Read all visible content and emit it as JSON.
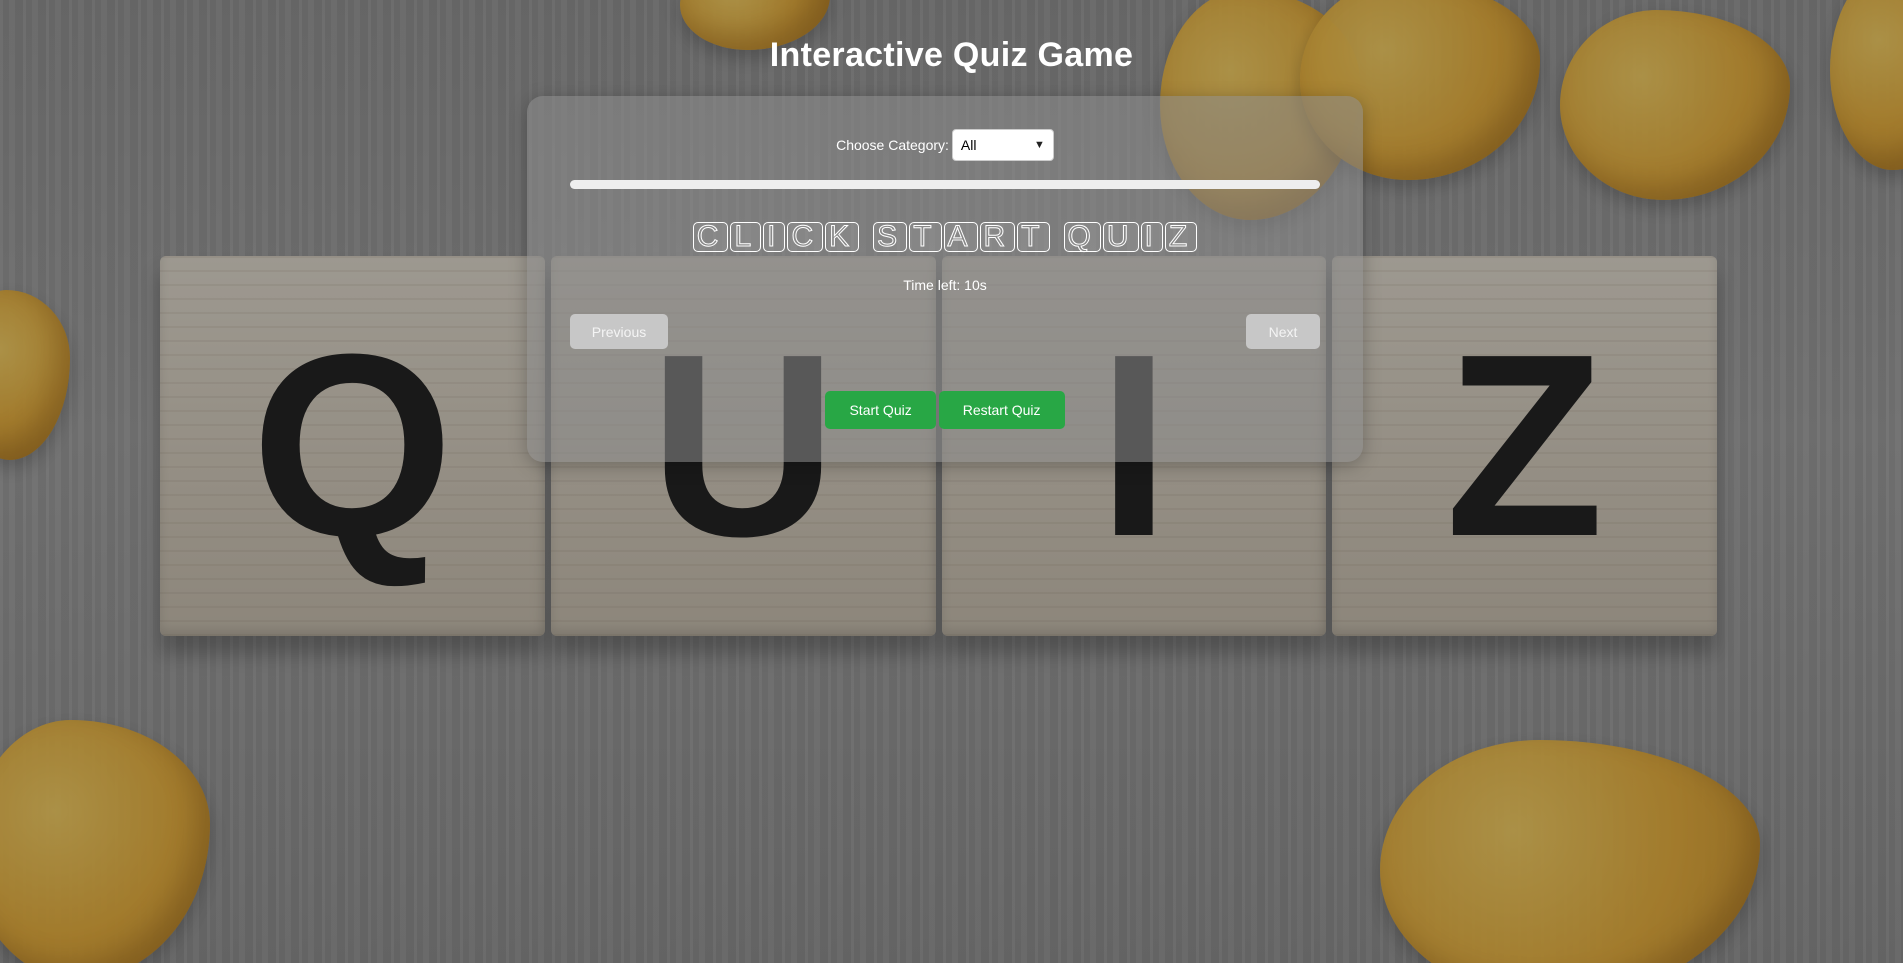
{
  "page": {
    "title": "Interactive Quiz Game"
  },
  "category": {
    "label": "Choose Category:",
    "selected": "All"
  },
  "progress": {
    "percent": 0
  },
  "question": {
    "text": "Click Start Quiz"
  },
  "timer": {
    "text": "Time left: 10s"
  },
  "nav": {
    "previous_label": "Previous",
    "next_label": "Next"
  },
  "actions": {
    "start_label": "Start Quiz",
    "restart_label": "Restart Quiz"
  },
  "background": {
    "letters": [
      "Q",
      "U",
      "I",
      "Z"
    ]
  },
  "colors": {
    "accent": "#28a745",
    "disabled": "#c7c7c7"
  }
}
